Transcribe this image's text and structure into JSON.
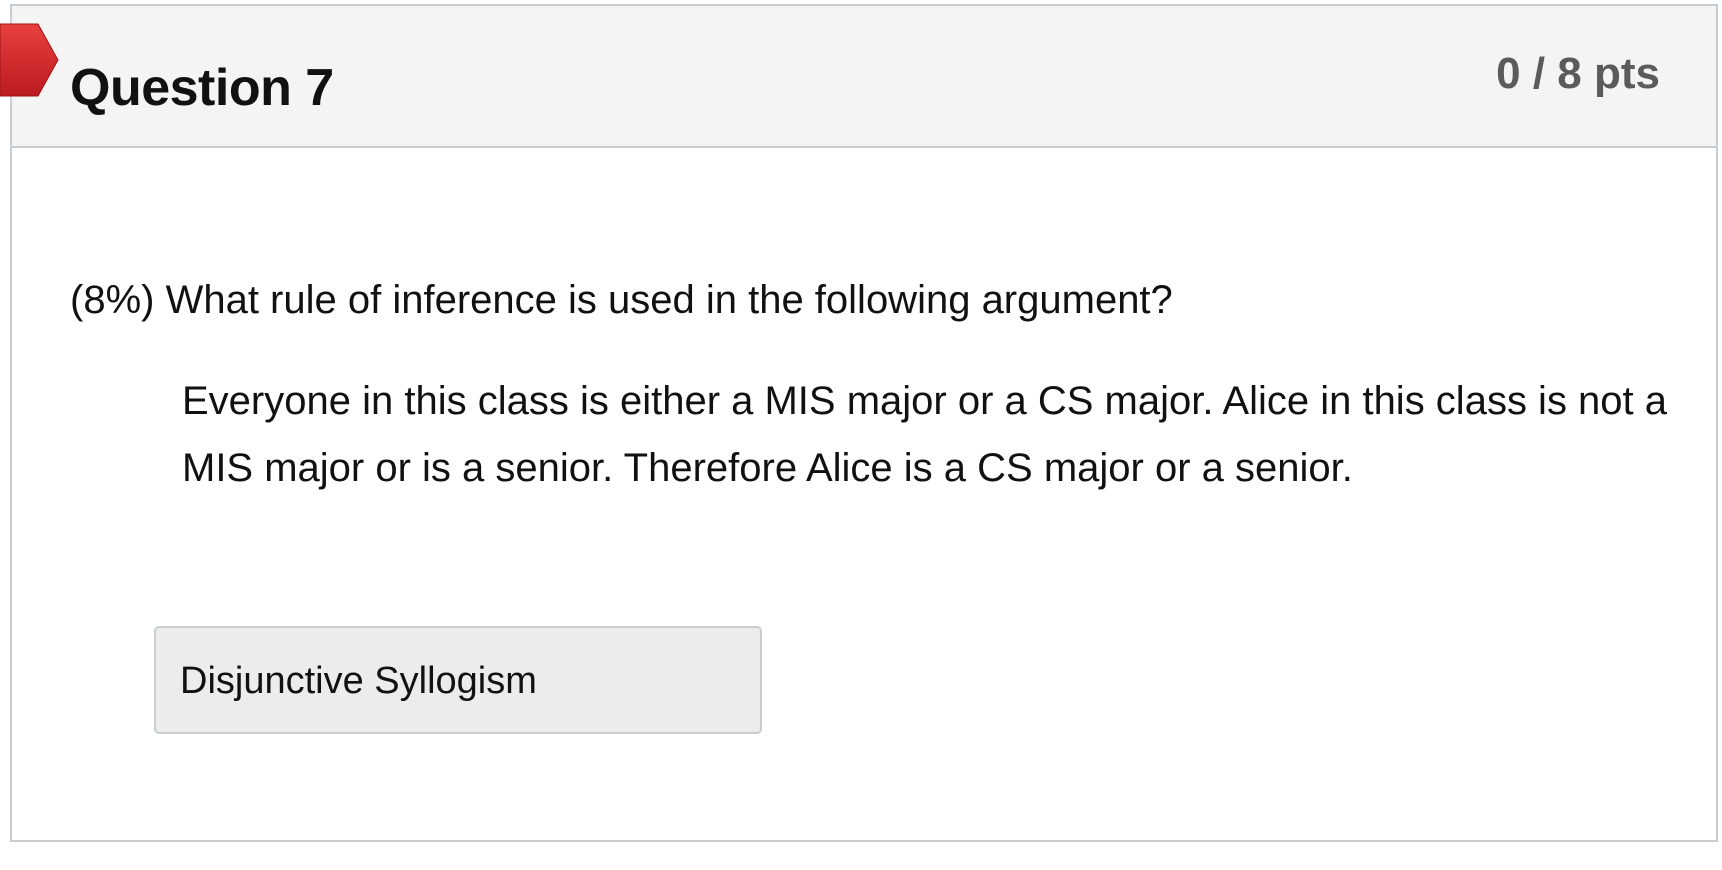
{
  "question": {
    "title": "Question 7",
    "points": "0 / 8 pts",
    "prompt": "(8%) What rule of inference is used in the following argument?",
    "argument": "Everyone in this class is either a MIS major or a CS major. Alice in this class is not a MIS major or is a senior. Therefore Alice is a CS major or a senior.",
    "answer": "Disjunctive Syllogism"
  },
  "colors": {
    "flag": "#d42326",
    "header_background": "#f4f4f4",
    "answer_background": "#ececec",
    "border": "#c7cdd1"
  },
  "icons": {
    "flag": "flag-icon"
  }
}
